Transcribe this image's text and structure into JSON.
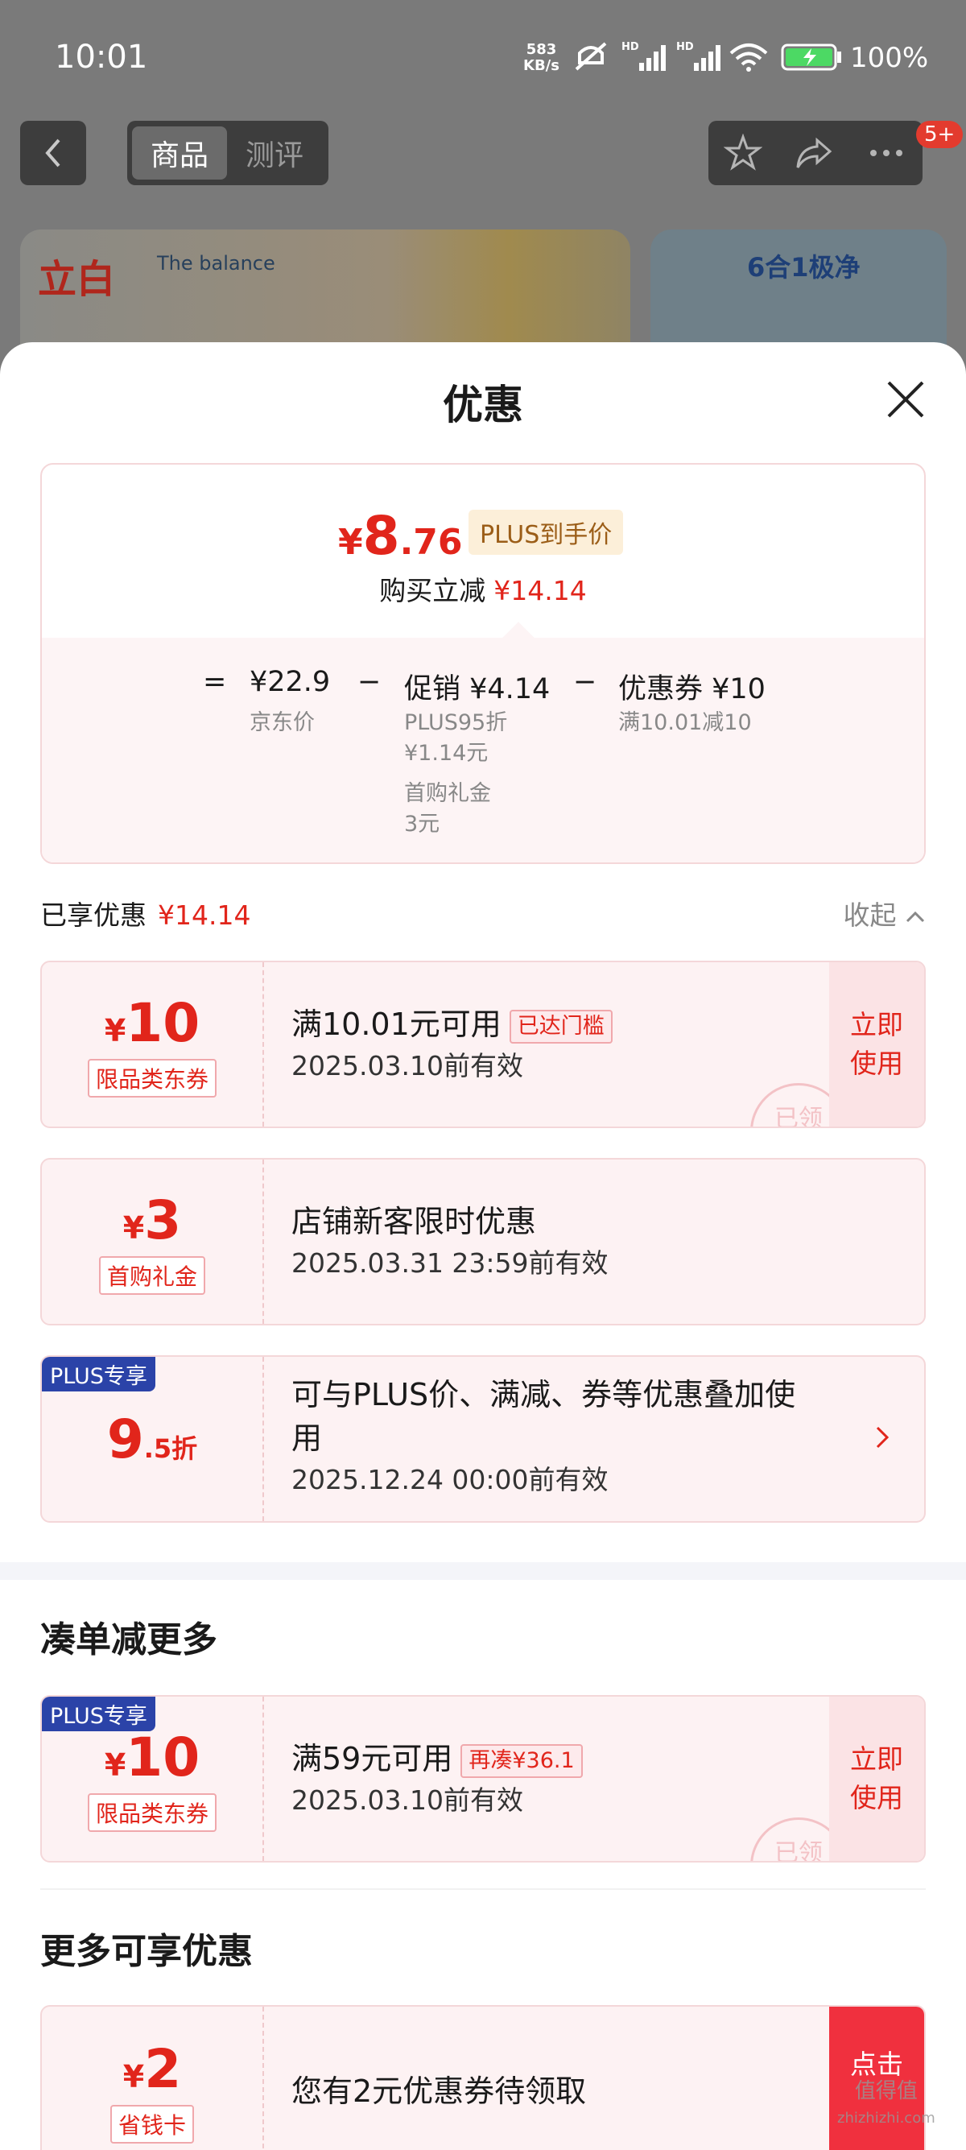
{
  "status_bar": {
    "time": "10:01",
    "net_speed": "583",
    "net_unit": "KB/s",
    "battery": "100%"
  },
  "nav": {
    "tab_product": "商品",
    "tab_review": "测评",
    "badge": "5+"
  },
  "banner": {
    "brand": "立白",
    "brand2": "The balance",
    "promo": "6合1极净"
  },
  "sheet": {
    "title": "优惠"
  },
  "summary": {
    "yen": "¥",
    "price_int": "8",
    "price_dec": ".76",
    "plus_label": "PLUS到手价",
    "reduce_label": "购买立减",
    "reduce_value": "¥14.14",
    "eq": "=",
    "minus": "−",
    "jd_price": "¥22.9",
    "jd_label": "京东价",
    "promo": "促销 ¥4.14",
    "promo_sub1": "PLUS95折",
    "promo_sub2": "¥1.14元",
    "promo_sub3": "首购礼金",
    "promo_sub4": "3元",
    "coupon": "优惠券 ¥10",
    "coupon_sub": "满10.01减10"
  },
  "enjoyed": {
    "label": "已享优惠",
    "value": "¥14.14",
    "collapse": "收起"
  },
  "cards": {
    "c1": {
      "yen": "¥",
      "amount": "10",
      "tag": "限品类东券",
      "title": "满10.01元可用",
      "cond": "已达门槛",
      "date": "2025.03.10前有效",
      "btn": "立即使用",
      "stamp": "已领"
    },
    "c2": {
      "yen": "¥",
      "amount": "3",
      "tag": "首购礼金",
      "title": "店铺新客限时优惠",
      "date": "2025.03.31 23:59前有效"
    },
    "c3": {
      "corner": "PLUS专享",
      "amount": "9",
      "amount_dec": ".5折",
      "title1": "可与PLUS价、满减、券等优惠叠加使",
      "title2": "用",
      "date": "2025.12.24 00:00前有效"
    },
    "c4": {
      "corner": "PLUS专享",
      "yen": "¥",
      "amount": "10",
      "tag": "限品类东券",
      "title": "满59元可用",
      "cond": "再凑¥36.1",
      "date": "2025.03.10前有效",
      "btn": "立即使用",
      "stamp": "已领"
    },
    "c5": {
      "yen": "¥",
      "amount": "2",
      "tag": "省钱卡",
      "title": "您有2元优惠券待领取",
      "btn": "点击"
    }
  },
  "sections": {
    "more_discount": "凑单减更多",
    "more_offers": "更多可享优惠"
  },
  "watermark": {
    "line1": "值得值",
    "line2": "zhizhizhi.com"
  },
  "colors": {
    "accent": "#e1251b",
    "plus_blue": "#2b43a8"
  }
}
